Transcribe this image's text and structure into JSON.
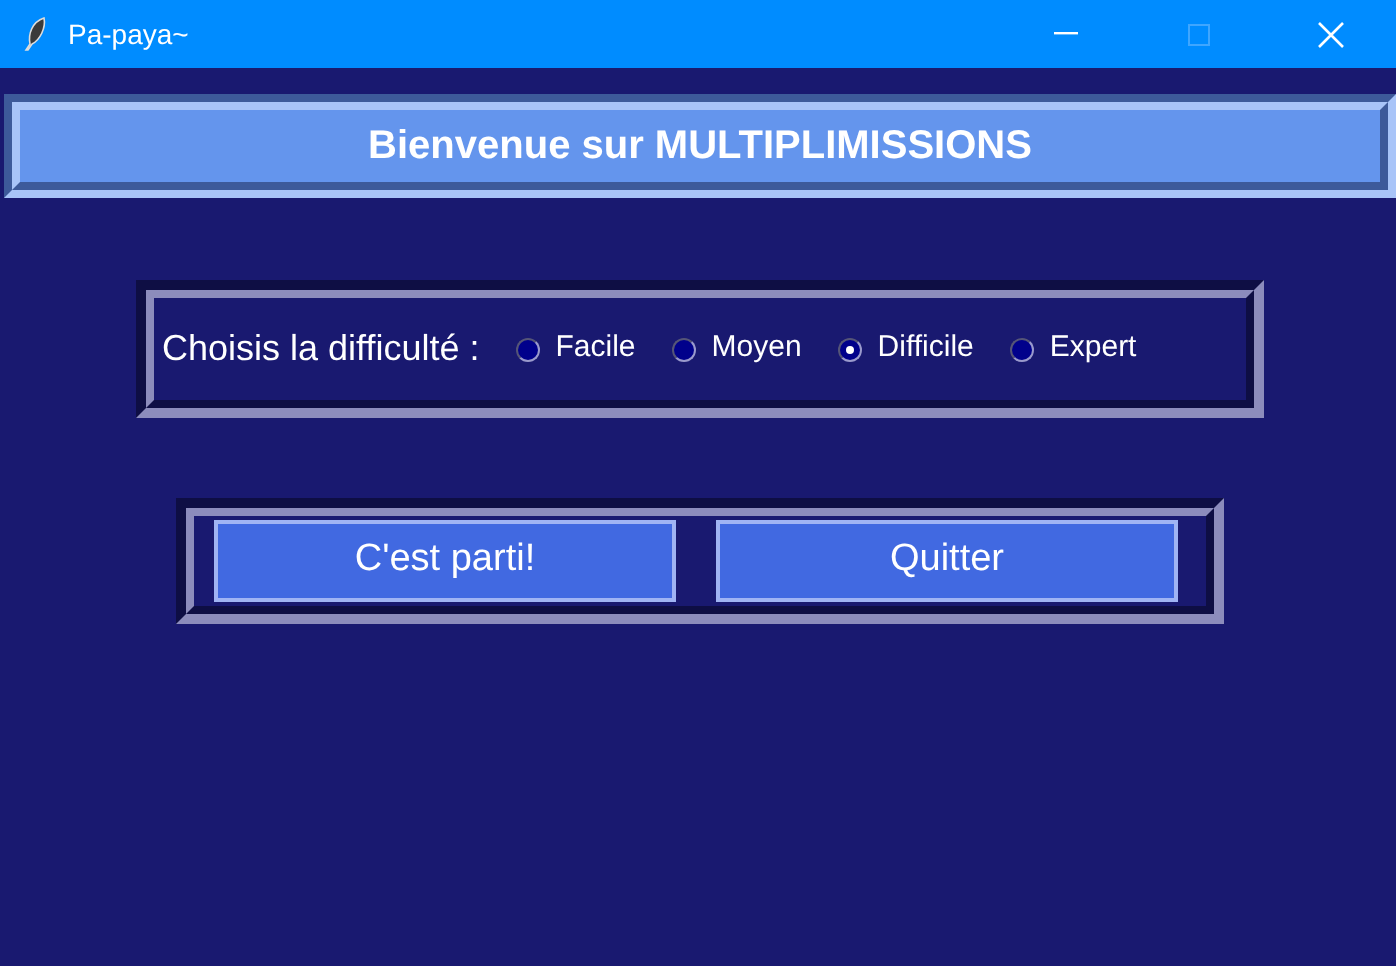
{
  "window": {
    "title": "Pa-paya~",
    "maximize_disabled": true
  },
  "header": {
    "title": "Bienvenue sur MULTIPLIMISSIONS"
  },
  "difficulty": {
    "label": "Choisis la difficulté :",
    "options": [
      {
        "label": "Facile",
        "selected": false
      },
      {
        "label": "Moyen",
        "selected": false
      },
      {
        "label": "Difficile",
        "selected": true
      },
      {
        "label": "Expert",
        "selected": false
      }
    ]
  },
  "buttons": [
    "C'est parti!",
    "Quitter"
  ]
}
